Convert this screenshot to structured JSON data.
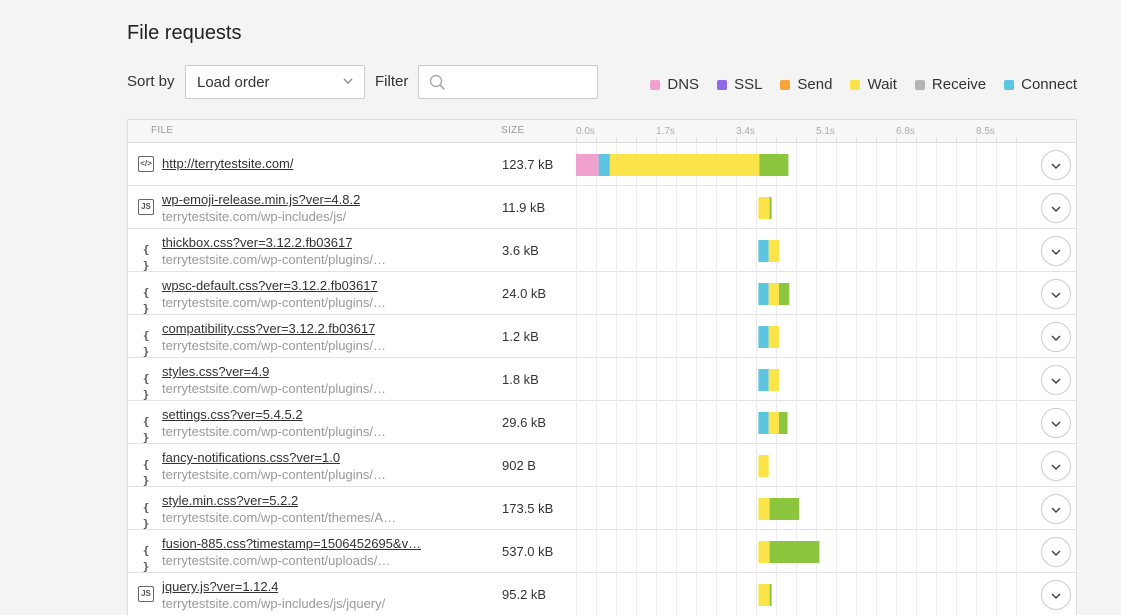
{
  "page": {
    "title": "File requests"
  },
  "toolbar": {
    "sort_label": "Sort by",
    "sort_value": "Load order",
    "filter_label": "Filter",
    "filter_value": "",
    "filter_placeholder": ""
  },
  "legend": [
    {
      "label": "DNS",
      "color": "#f0a1cf"
    },
    {
      "label": "SSL",
      "color": "#8e6ae8"
    },
    {
      "label": "Send",
      "color": "#f5a63a"
    },
    {
      "label": "Wait",
      "color": "#fbe34a"
    },
    {
      "label": "Receive",
      "color": "#b5b5b5"
    },
    {
      "label": "Connect",
      "color": "#5bc5e2"
    }
  ],
  "table": {
    "headers": {
      "file": "FILE",
      "size": "SIZE"
    },
    "ticks": [
      "0.0s",
      "1.7s",
      "3.4s",
      "5.1s",
      "6.8s",
      "8.5s"
    ],
    "rows": [
      {
        "name": "http://terrytestsite.com/",
        "path": "",
        "size": "123.7 kB",
        "icon": "html-file-icon",
        "timing": [
          {
            "phase": "DNS",
            "color": "#f0a1cf",
            "start": 0.0,
            "end": 0.48
          },
          {
            "phase": "Connect",
            "color": "#5bc5e2",
            "start": 0.48,
            "end": 0.72
          },
          {
            "phase": "Wait",
            "color": "#fbe34a",
            "start": 0.72,
            "end": 3.9
          },
          {
            "phase": "Receive",
            "color": "#8cc63f",
            "start": 3.9,
            "end": 4.52
          }
        ]
      },
      {
        "name": "wp-emoji-release.min.js?ver=4.8.2",
        "path": "terrytestsite.com/wp-includes/js/",
        "size": "11.9 kB",
        "icon": "js-file-icon",
        "timing": [
          {
            "phase": "Wait",
            "color": "#fbe34a",
            "start": 3.88,
            "end": 4.12
          },
          {
            "phase": "Receive",
            "color": "#8cc63f",
            "start": 4.12,
            "end": 4.16
          }
        ]
      },
      {
        "name": "thickbox.css?ver=3.12.2.fb03617",
        "path": "terrytestsite.com/wp-content/plugins/…",
        "size": "3.6 kB",
        "icon": "css-file-icon",
        "timing": [
          {
            "phase": "Connect",
            "color": "#5bc5e2",
            "start": 3.88,
            "end": 4.1
          },
          {
            "phase": "Wait",
            "color": "#fbe34a",
            "start": 4.1,
            "end": 4.32
          }
        ]
      },
      {
        "name": "wpsc-default.css?ver=3.12.2.fb03617",
        "path": "terrytestsite.com/wp-content/plugins/…",
        "size": "24.0 kB",
        "icon": "css-file-icon",
        "timing": [
          {
            "phase": "Connect",
            "color": "#5bc5e2",
            "start": 3.88,
            "end": 4.1
          },
          {
            "phase": "Wait",
            "color": "#fbe34a",
            "start": 4.1,
            "end": 4.32
          },
          {
            "phase": "Receive",
            "color": "#8cc63f",
            "start": 4.32,
            "end": 4.54
          }
        ]
      },
      {
        "name": "compatibility.css?ver=3.12.2.fb03617",
        "path": "terrytestsite.com/wp-content/plugins/…",
        "size": "1.2 kB",
        "icon": "css-file-icon",
        "timing": [
          {
            "phase": "Connect",
            "color": "#5bc5e2",
            "start": 3.88,
            "end": 4.1
          },
          {
            "phase": "Wait",
            "color": "#fbe34a",
            "start": 4.1,
            "end": 4.32
          }
        ]
      },
      {
        "name": "styles.css?ver=4.9",
        "path": "terrytestsite.com/wp-content/plugins/…",
        "size": "1.8 kB",
        "icon": "css-file-icon",
        "timing": [
          {
            "phase": "Connect",
            "color": "#5bc5e2",
            "start": 3.88,
            "end": 4.1
          },
          {
            "phase": "Wait",
            "color": "#fbe34a",
            "start": 4.1,
            "end": 4.32
          }
        ]
      },
      {
        "name": "settings.css?ver=5.4.5.2",
        "path": "terrytestsite.com/wp-content/plugins/…",
        "size": "29.6 kB",
        "icon": "css-file-icon",
        "timing": [
          {
            "phase": "Connect",
            "color": "#5bc5e2",
            "start": 3.88,
            "end": 4.1
          },
          {
            "phase": "Wait",
            "color": "#fbe34a",
            "start": 4.1,
            "end": 4.32
          },
          {
            "phase": "Receive",
            "color": "#8cc63f",
            "start": 4.32,
            "end": 4.5
          }
        ]
      },
      {
        "name": "fancy-notifications.css?ver=1.0",
        "path": "terrytestsite.com/wp-content/plugins/…",
        "size": "902 B",
        "icon": "css-file-icon",
        "timing": [
          {
            "phase": "Wait",
            "color": "#fbe34a",
            "start": 3.88,
            "end": 4.1
          }
        ]
      },
      {
        "name": "style.min.css?ver=5.2.2",
        "path": "terrytestsite.com/wp-content/themes/A…",
        "size": "173.5 kB",
        "icon": "css-file-icon",
        "timing": [
          {
            "phase": "Wait",
            "color": "#fbe34a",
            "start": 3.88,
            "end": 4.12
          },
          {
            "phase": "Receive",
            "color": "#8cc63f",
            "start": 4.12,
            "end": 4.75
          }
        ]
      },
      {
        "name": "fusion-885.css?timestamp=1506452695&v…",
        "path": "terrytestsite.com/wp-content/uploads/…",
        "size": "537.0 kB",
        "icon": "css-file-icon",
        "timing": [
          {
            "phase": "Wait",
            "color": "#fbe34a",
            "start": 3.88,
            "end": 4.12
          },
          {
            "phase": "Receive",
            "color": "#8cc63f",
            "start": 4.12,
            "end": 5.18
          }
        ]
      },
      {
        "name": "jquery.js?ver=1.12.4",
        "path": "terrytestsite.com/wp-includes/js/jquery/",
        "size": "95.2 kB",
        "icon": "js-file-icon",
        "timing": [
          {
            "phase": "Wait",
            "color": "#fbe34a",
            "start": 3.88,
            "end": 4.12
          },
          {
            "phase": "Receive",
            "color": "#8cc63f",
            "start": 4.12,
            "end": 4.16
          }
        ]
      }
    ]
  }
}
